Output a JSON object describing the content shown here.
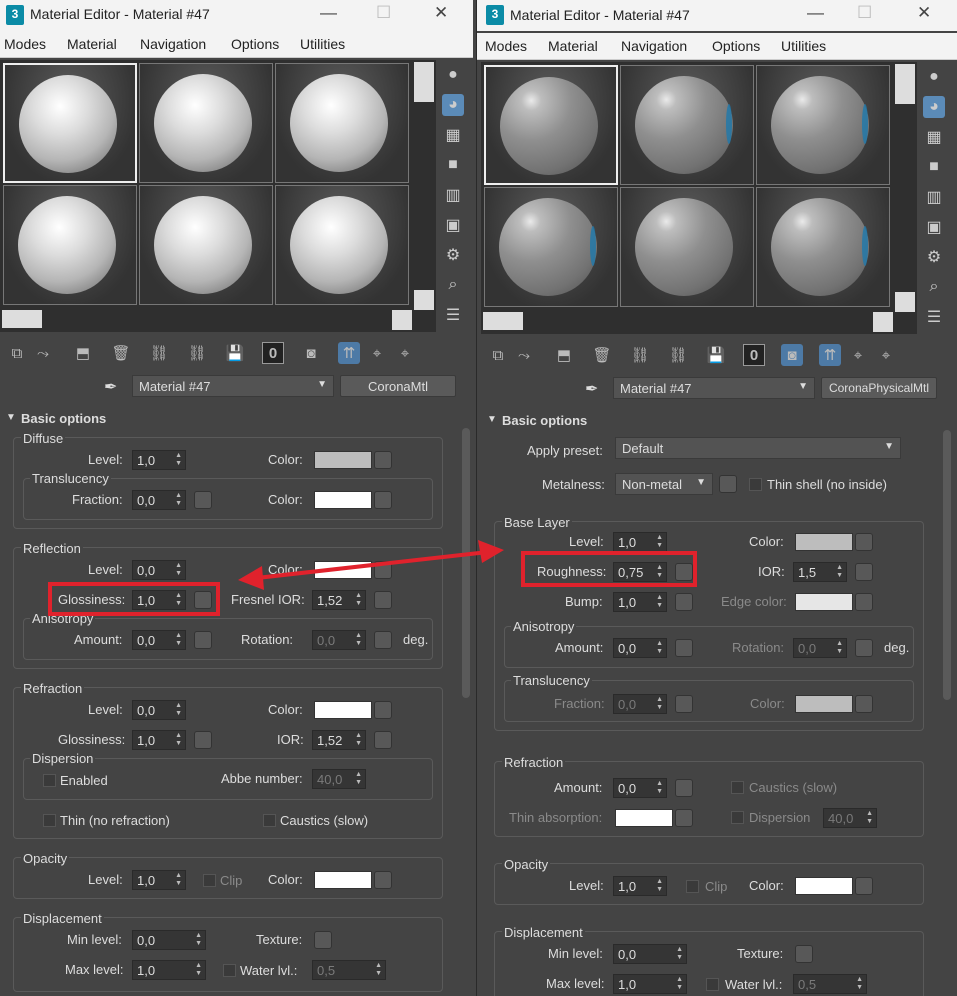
{
  "left": {
    "title": "Material Editor - Material #47",
    "menu": [
      "Modes",
      "Material",
      "Navigation",
      "Options",
      "Utilities"
    ],
    "material_name": "Material #47",
    "material_type": "CoronaMtl",
    "section": "Basic options",
    "diffuse": {
      "title": "Diffuse",
      "level_label": "Level:",
      "level": "1,0",
      "color_label": "Color:",
      "color": "#bdbdbd",
      "translucency": "Translucency",
      "fraction_label": "Fraction:",
      "fraction": "0,0",
      "color2_label": "Color:",
      "color2": "#ffffff"
    },
    "reflection": {
      "title": "Reflection",
      "level_label": "Level:",
      "level": "0,0",
      "color_label": "Color:",
      "color": "#ffffff",
      "gloss_label": "Glossiness:",
      "gloss": "1,0",
      "fresnel_label": "Fresnel IOR:",
      "fresnel": "1,52",
      "aniso": "Anisotropy",
      "amount_label": "Amount:",
      "amount": "0,0",
      "rotation_label": "Rotation:",
      "rotation": "0,0",
      "deg": "deg."
    },
    "refraction": {
      "title": "Refraction",
      "level_label": "Level:",
      "level": "0,0",
      "color_label": "Color:",
      "color": "#ffffff",
      "gloss_label": "Glossiness:",
      "gloss": "1,0",
      "ior_label": "IOR:",
      "ior": "1,52",
      "dispersion": "Dispersion",
      "enabled": "Enabled",
      "abbe_label": "Abbe number:",
      "abbe": "40,0",
      "thin": "Thin (no refraction)",
      "caustics": "Caustics (slow)"
    },
    "opacity": {
      "title": "Opacity",
      "level_label": "Level:",
      "level": "1,0",
      "clip": "Clip",
      "color_label": "Color:",
      "color": "#ffffff"
    },
    "displacement": {
      "title": "Displacement",
      "min_label": "Min level:",
      "min": "0,0",
      "texture_label": "Texture:",
      "max_label": "Max level:",
      "max": "1,0",
      "water_label": "Water lvl.:",
      "water": "0,5"
    }
  },
  "right": {
    "title": "Material Editor - Material #47",
    "menu": [
      "Modes",
      "Material",
      "Navigation",
      "Options",
      "Utilities"
    ],
    "material_name": "Material #47",
    "material_type": "CoronaPhysicalMtl",
    "section": "Basic options",
    "preset_label": "Apply preset:",
    "preset": "Default",
    "metalness_label": "Metalness:",
    "metalness": "Non-metal",
    "thin_shell": "Thin shell (no inside)",
    "base": {
      "title": "Base Layer",
      "level_label": "Level:",
      "level": "1,0",
      "color_label": "Color:",
      "color": "#bdbdbd",
      "rough_label": "Roughness:",
      "rough": "0,75",
      "ior_label": "IOR:",
      "ior": "1,5",
      "bump_label": "Bump:",
      "bump": "1,0",
      "edge_label": "Edge color:",
      "edge": "#e6e6e6",
      "aniso": "Anisotropy",
      "amount_label": "Amount:",
      "amount": "0,0",
      "rotation_label": "Rotation:",
      "rotation": "0,0",
      "deg": "deg.",
      "transl": "Translucency",
      "fraction_label": "Fraction:",
      "fraction": "0,0",
      "tcolor_label": "Color:",
      "tcolor": "#bdbdbd"
    },
    "refraction": {
      "title": "Refraction",
      "amount_label": "Amount:",
      "amount": "0,0",
      "caustics": "Caustics (slow)",
      "thin_abs_label": "Thin absorption:",
      "thin_abs": "#ffffff",
      "dispersion": "Dispersion",
      "dispersion_val": "40,0"
    },
    "opacity": {
      "title": "Opacity",
      "level_label": "Level:",
      "level": "1,0",
      "clip": "Clip",
      "color_label": "Color:",
      "color": "#ffffff"
    },
    "displacement": {
      "title": "Displacement",
      "min_label": "Min level:",
      "min": "0,0",
      "texture_label": "Texture:",
      "max_label": "Max level:",
      "max": "1,0",
      "water_label": "Water lvl.:",
      "water": "0,5"
    }
  },
  "accent": {
    "highlight": "#e0222c",
    "active_icon": "#5b8bb8"
  }
}
